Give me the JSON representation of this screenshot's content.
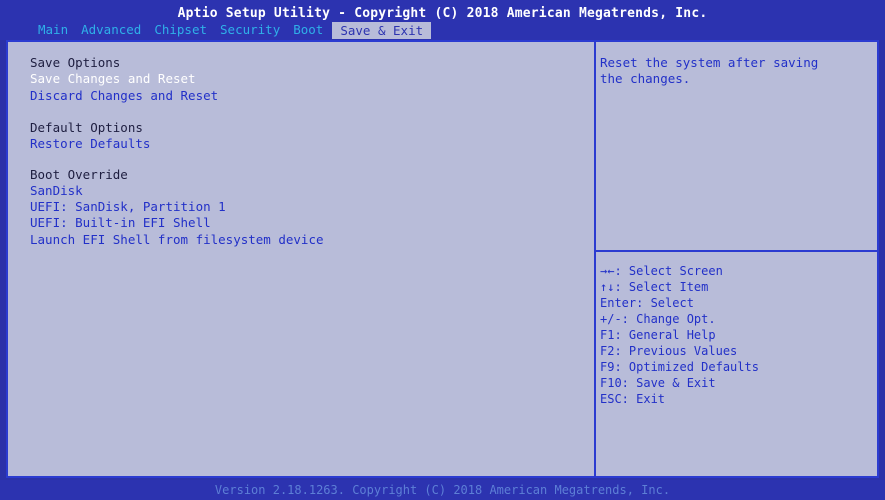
{
  "header": {
    "title": "Aptio Setup Utility - Copyright (C) 2018 American Megatrends, Inc.",
    "tabs": [
      {
        "label": "Main"
      },
      {
        "label": "Advanced"
      },
      {
        "label": "Chipset"
      },
      {
        "label": "Security"
      },
      {
        "label": "Boot"
      },
      {
        "label": "Save & Exit",
        "active": true
      }
    ]
  },
  "left": {
    "save_options": {
      "heading": "Save Options",
      "items": [
        "Save Changes and Reset",
        "Discard Changes and Reset"
      ]
    },
    "default_options": {
      "heading": "Default Options",
      "items": [
        "Restore Defaults"
      ]
    },
    "boot_override": {
      "heading": "Boot Override",
      "items": [
        "SanDisk",
        "UEFI: SanDisk, Partition 1",
        "UEFI: Built-in EFI Shell",
        "Launch EFI Shell from filesystem device"
      ]
    }
  },
  "help": {
    "line1": "Reset the system after saving",
    "line2": "the changes."
  },
  "keys": [
    "→←: Select Screen",
    "↑↓: Select Item",
    "Enter: Select",
    "+/-: Change Opt.",
    "F1: General Help",
    "F2: Previous Values",
    "F9: Optimized Defaults",
    "F10: Save & Exit",
    "ESC: Exit"
  ],
  "footer": {
    "version": "Version 2.18.1263. Copyright (C) 2018 American Megatrends, Inc."
  },
  "colors": {
    "background": "#2c33b0",
    "panel": "#b8bcd9",
    "selectable_text": "#2230c8",
    "selected_text": "#ffffff",
    "tab_text": "#2fb0e8"
  }
}
